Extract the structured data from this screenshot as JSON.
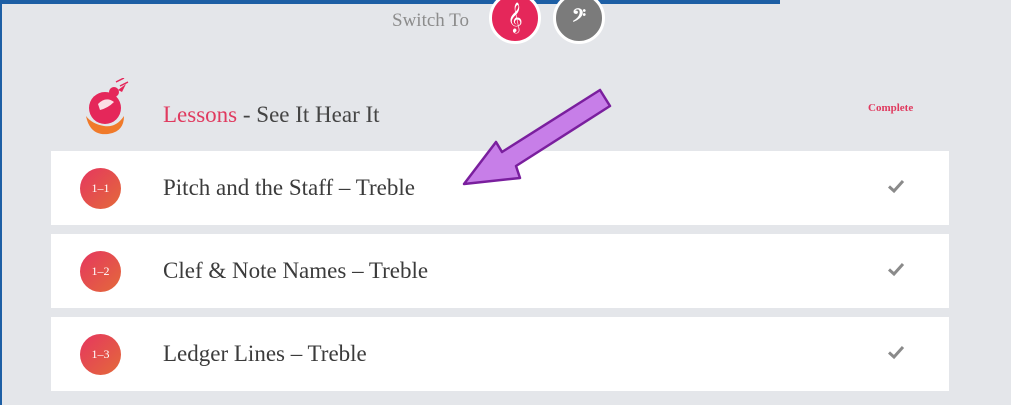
{
  "switch": {
    "label": "Switch To",
    "treble_icon": "treble-clef-icon",
    "bass_icon": "bass-clef-icon"
  },
  "header": {
    "title_accent": "Lessons",
    "title_rest": " - See It Hear It",
    "status": "Complete"
  },
  "lessons": [
    {
      "badge": "1–1",
      "title": "Pitch and the Staff – Treble",
      "completed": true
    },
    {
      "badge": "1–2",
      "title": "Clef & Note Names – Treble",
      "completed": true
    },
    {
      "badge": "1–3",
      "title": "Ledger Lines – Treble",
      "completed": true
    }
  ],
  "colors": {
    "accent": "#e03a5f",
    "frame": "#1d5fa5",
    "arrow": "#c77ee8",
    "background": "#e4e6ea"
  }
}
